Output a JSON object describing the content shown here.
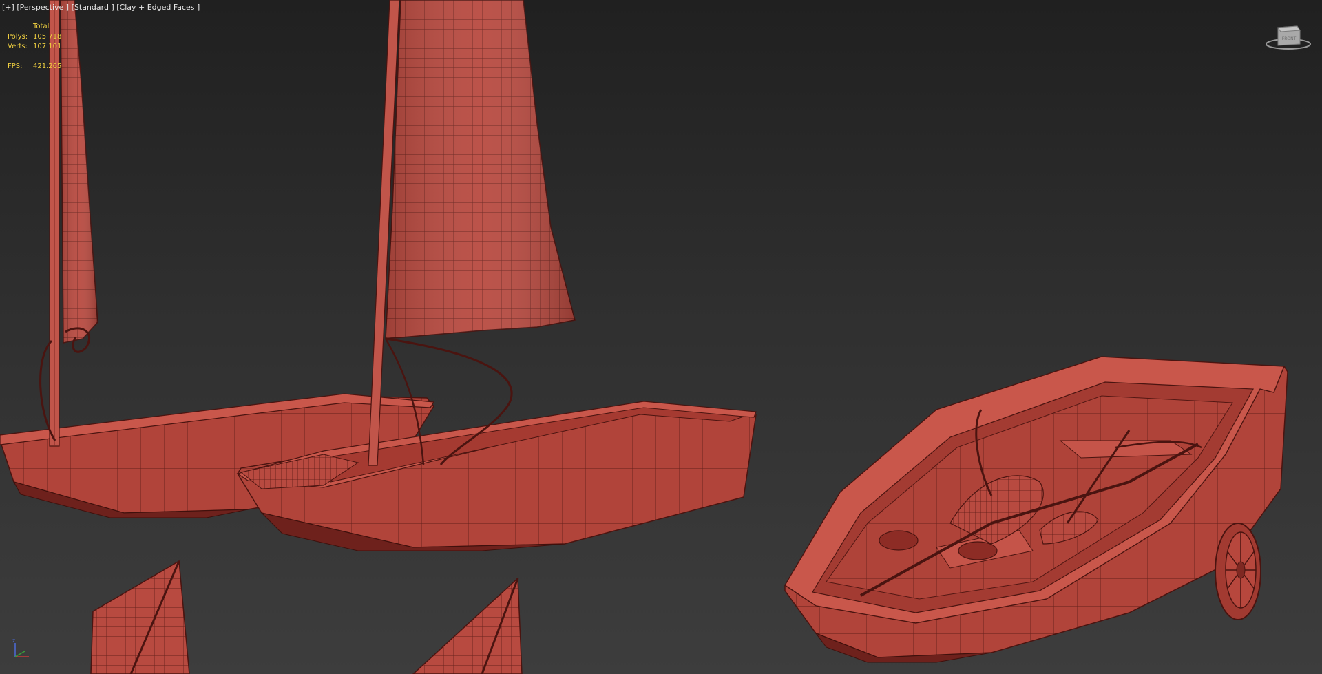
{
  "viewport": {
    "menu_label": "[+]",
    "view_label": "[Perspective ]",
    "shading_label": "[Standard ]",
    "style_label": "[Clay + Edged Faces ]"
  },
  "stats": {
    "header": "Total",
    "polys_label": "Polys:",
    "polys_value": "105 718",
    "verts_label": "Verts:",
    "verts_value": "107 101",
    "fps_label": "FPS:",
    "fps_value": "421.265"
  },
  "viewcube": {
    "face_label": "FRONT",
    "icon": "viewcube-icon"
  },
  "axis": {
    "z_label": "z",
    "icon": "axis-tripod-icon"
  },
  "colors": {
    "model_fill": "#b6453c",
    "model_dark": "#7e2822",
    "model_light": "#cf6459",
    "wire": "#4a1410",
    "stats_text": "#f0d040",
    "label_text": "#e6e6e6"
  }
}
